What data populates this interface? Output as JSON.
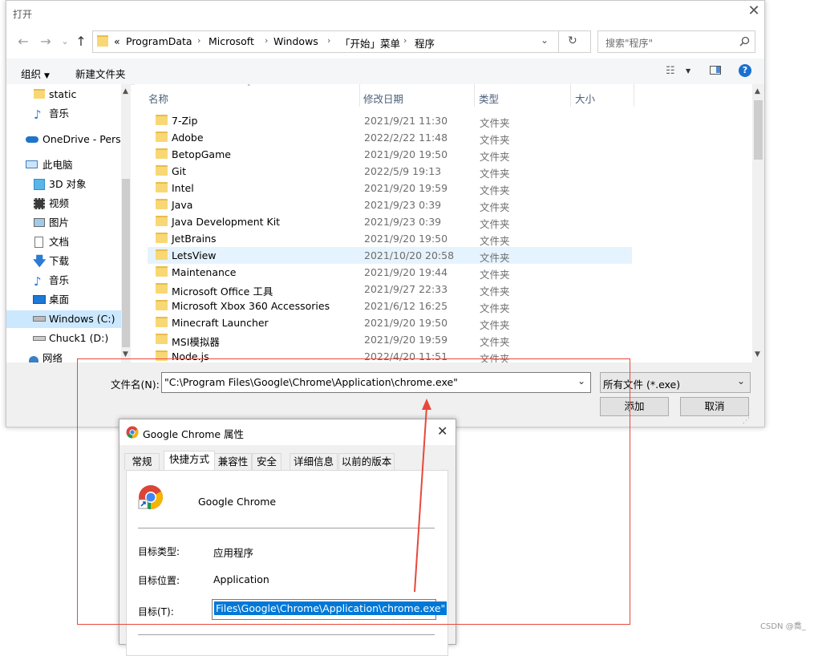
{
  "open_dialog": {
    "title": "打开",
    "close": "✕",
    "address": {
      "overflow": "«",
      "segments": [
        "ProgramData",
        "Microsoft",
        "Windows",
        "「开始」菜单",
        "程序"
      ],
      "separator": "›"
    },
    "search_placeholder": "搜索\"程序\"",
    "toolbar": {
      "organize": "组织",
      "new_folder": "新建文件夹"
    },
    "nav": [
      {
        "label": "static",
        "icon": "folder-icon"
      },
      {
        "label": "音乐",
        "icon": "music-icon"
      },
      {
        "label": "OneDrive - Perso",
        "icon": "cloud-icon"
      },
      {
        "label": "此电脑",
        "icon": "pc-icon"
      },
      {
        "label": "3D 对象",
        "icon": "cube-icon"
      },
      {
        "label": "视频",
        "icon": "video-icon"
      },
      {
        "label": "图片",
        "icon": "picture-icon"
      },
      {
        "label": "文档",
        "icon": "document-icon"
      },
      {
        "label": "下载",
        "icon": "download-icon"
      },
      {
        "label": "音乐",
        "icon": "music-icon"
      },
      {
        "label": "桌面",
        "icon": "desktop-icon"
      },
      {
        "label": "Windows (C:)",
        "icon": "drive-icon"
      },
      {
        "label": "Chuck1 (D:)",
        "icon": "drive-icon"
      },
      {
        "label": "网络",
        "icon": "network-icon"
      }
    ],
    "columns": [
      "名称",
      "修改日期",
      "类型",
      "大小"
    ],
    "files": [
      {
        "name": "7-Zip",
        "date": "2021/9/21 11:30",
        "type": "文件夹"
      },
      {
        "name": "Adobe",
        "date": "2022/2/22 11:48",
        "type": "文件夹"
      },
      {
        "name": "BetopGame",
        "date": "2021/9/20 19:50",
        "type": "文件夹"
      },
      {
        "name": "Git",
        "date": "2022/5/9 19:13",
        "type": "文件夹"
      },
      {
        "name": "Intel",
        "date": "2021/9/20 19:59",
        "type": "文件夹"
      },
      {
        "name": "Java",
        "date": "2021/9/23 0:39",
        "type": "文件夹"
      },
      {
        "name": "Java Development Kit",
        "date": "2021/9/23 0:39",
        "type": "文件夹"
      },
      {
        "name": "JetBrains",
        "date": "2021/9/20 19:50",
        "type": "文件夹"
      },
      {
        "name": "LetsView",
        "date": "2021/10/20 20:58",
        "type": "文件夹"
      },
      {
        "name": "Maintenance",
        "date": "2021/9/20 19:44",
        "type": "文件夹"
      },
      {
        "name": "Microsoft Office 工具",
        "date": "2021/9/27 22:33",
        "type": "文件夹"
      },
      {
        "name": "Microsoft Xbox 360 Accessories",
        "date": "2021/6/12 16:25",
        "type": "文件夹"
      },
      {
        "name": "Minecraft Launcher",
        "date": "2021/9/20 19:50",
        "type": "文件夹"
      },
      {
        "name": "MSI模拟器",
        "date": "2021/9/20 19:59",
        "type": "文件夹"
      },
      {
        "name": "Node.js",
        "date": "2022/4/20 11:51",
        "type": "文件夹"
      }
    ],
    "filename_label": "文件名(N):",
    "filename_value": "\"C:\\Program Files\\Google\\Chrome\\Application\\chrome.exe\"",
    "filetype_value": "所有文件 (*.exe)",
    "add_button": "添加",
    "cancel_button": "取消"
  },
  "properties_dialog": {
    "title": "Google Chrome 属性",
    "close": "✕",
    "tabs": [
      "常规",
      "快捷方式",
      "兼容性",
      "安全",
      "详细信息",
      "以前的版本"
    ],
    "active_tab": "快捷方式",
    "app_name": "Google Chrome",
    "target_type_label": "目标类型:",
    "target_type_value": "应用程序",
    "target_location_label": "目标位置:",
    "target_location_value": "Application",
    "target_label": "目标(T):",
    "target_value": "Files\\Google\\Chrome\\Application\\chrome.exe\""
  },
  "watermark": "CSDN @喬_",
  "colors": {
    "selection": "#0078d7",
    "row_highlight": "#e5f3ff",
    "annotation": "#e8483c",
    "folder": "#f8d775"
  }
}
